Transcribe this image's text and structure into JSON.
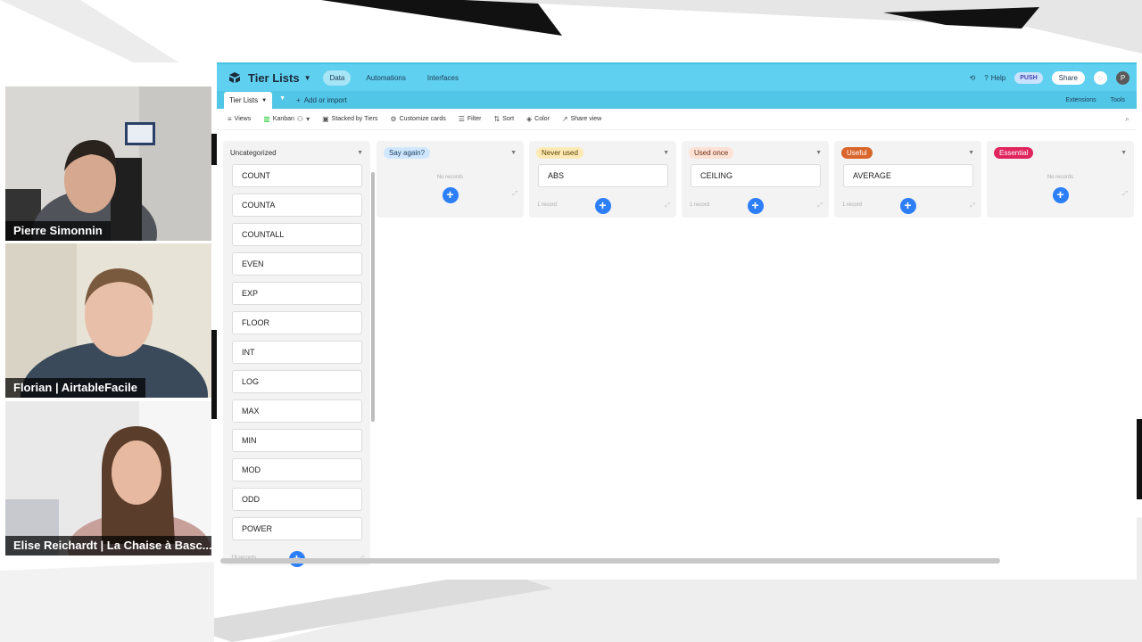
{
  "participants": [
    {
      "name": "Pierre Simonnin"
    },
    {
      "name": "Florian | AirtableFacile"
    },
    {
      "name": "Elise Reichardt | La Chaise à Basc..."
    }
  ],
  "topbar": {
    "base_title": "Tier Lists",
    "nav": [
      "Data",
      "Automations",
      "Interfaces"
    ],
    "help": "Help",
    "push": "PUSH",
    "share": "Share",
    "avatar_initial": "P"
  },
  "tablebar": {
    "table_tab": "Tier Lists",
    "add_import": "Add or import",
    "extensions": "Extensions",
    "tools": "Tools"
  },
  "viewbar": {
    "views": "Views",
    "view_name": "Kanban",
    "stacked": "Stacked by Tiers",
    "customize": "Customize cards",
    "filter": "Filter",
    "sort": "Sort",
    "color": "Color",
    "share_view": "Share view"
  },
  "columns": [
    {
      "title": "Uncategorized",
      "chip_bg": "",
      "chip_fg": "",
      "cards": [
        "COUNT",
        "COUNTA",
        "COUNTALL",
        "EVEN",
        "EXP",
        "FLOOR",
        "INT",
        "LOG",
        "MAX",
        "MIN",
        "MOD",
        "ODD",
        "POWER"
      ],
      "count": "19 records"
    },
    {
      "title": "Say again?",
      "chip_bg": "#cfe8ff",
      "chip_fg": "#1d3a5c",
      "cards": [],
      "empty": "No records",
      "count": ""
    },
    {
      "title": "Never used",
      "chip_bg": "#ffeab6",
      "chip_fg": "#5a4200",
      "cards": [
        "ABS"
      ],
      "count": "1 record"
    },
    {
      "title": "Used once",
      "chip_bg": "#fee2d5",
      "chip_fg": "#6b2c12",
      "cards": [
        "CEILING"
      ],
      "count": "1 record"
    },
    {
      "title": "Useful",
      "chip_bg": "#d9652b",
      "chip_fg": "#ffffff",
      "cards": [
        "AVERAGE"
      ],
      "count": "1 record"
    },
    {
      "title": "Essential",
      "chip_bg": "#e0245e",
      "chip_fg": "#ffffff",
      "cards": [],
      "empty": "No records",
      "count": ""
    }
  ]
}
